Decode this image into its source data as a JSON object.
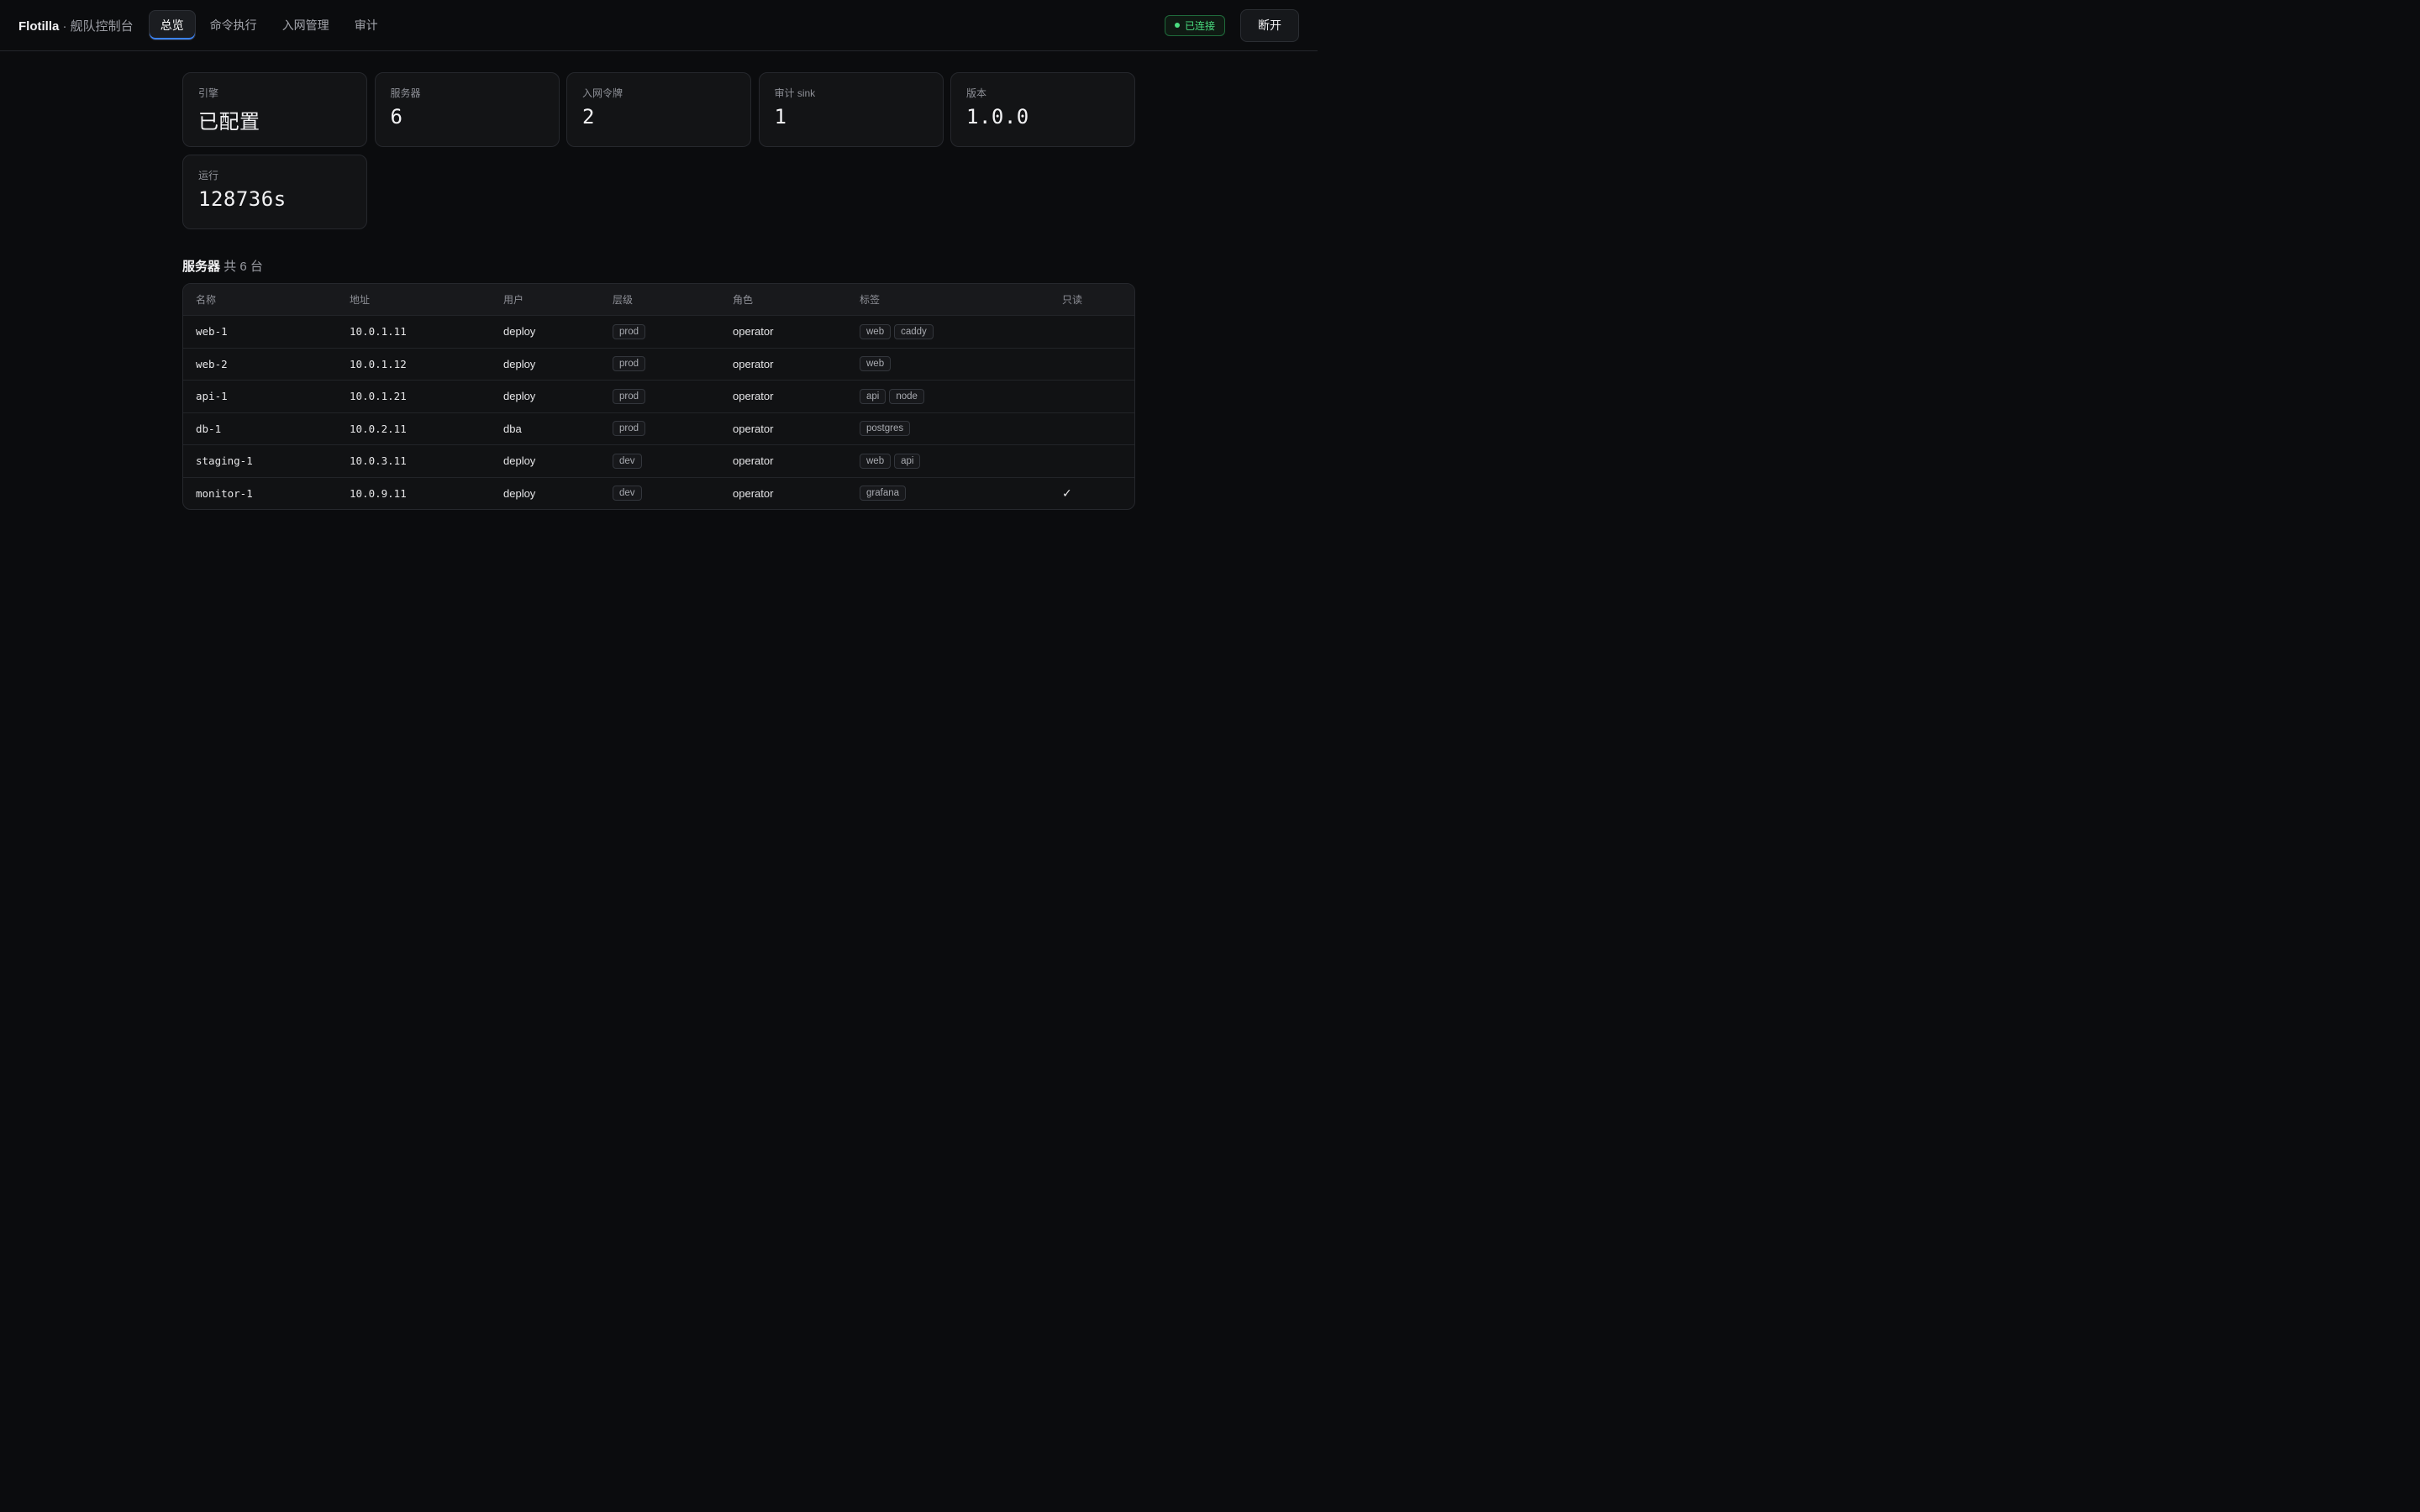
{
  "header": {
    "brand": "Flotilla",
    "brand_sub": " · 舰队控制台",
    "tabs": [
      "总览",
      "命令执行",
      "入网管理",
      "审计"
    ],
    "status": "已连接",
    "disconnect": "断开"
  },
  "cards": [
    {
      "label": "引擎",
      "value": "已配置"
    },
    {
      "label": "服务器",
      "value": "6"
    },
    {
      "label": "入网令牌",
      "value": "2"
    },
    {
      "label": "审计 sink",
      "value": "1"
    },
    {
      "label": "版本",
      "value": "1.0.0"
    },
    {
      "label": "运行",
      "value": "128736s"
    }
  ],
  "servers": {
    "title": "服务器",
    "count": " 共 6 台",
    "columns": [
      "名称",
      "地址",
      "用户",
      "层级",
      "角色",
      "标签",
      "只读"
    ],
    "rows": [
      {
        "name": "web-1",
        "addr": "10.0.1.11",
        "user": "deploy",
        "tier": "prod",
        "role": "operator",
        "tags": [
          "web",
          "caddy"
        ],
        "readonly": ""
      },
      {
        "name": "web-2",
        "addr": "10.0.1.12",
        "user": "deploy",
        "tier": "prod",
        "role": "operator",
        "tags": [
          "web"
        ],
        "readonly": ""
      },
      {
        "name": "api-1",
        "addr": "10.0.1.21",
        "user": "deploy",
        "tier": "prod",
        "role": "operator",
        "tags": [
          "api",
          "node"
        ],
        "readonly": ""
      },
      {
        "name": "db-1",
        "addr": "10.0.2.11",
        "user": "dba",
        "tier": "prod",
        "role": "operator",
        "tags": [
          "postgres"
        ],
        "readonly": ""
      },
      {
        "name": "staging-1",
        "addr": "10.0.3.11",
        "user": "deploy",
        "tier": "dev",
        "role": "operator",
        "tags": [
          "web",
          "api"
        ],
        "readonly": ""
      },
      {
        "name": "monitor-1",
        "addr": "10.0.9.11",
        "user": "deploy",
        "tier": "dev",
        "role": "operator",
        "tags": [
          "grafana"
        ],
        "readonly": "✓"
      }
    ]
  },
  "colors": {
    "accent": "#3b82f6",
    "connected": "#4ade80",
    "background": "#0b0c0e"
  }
}
